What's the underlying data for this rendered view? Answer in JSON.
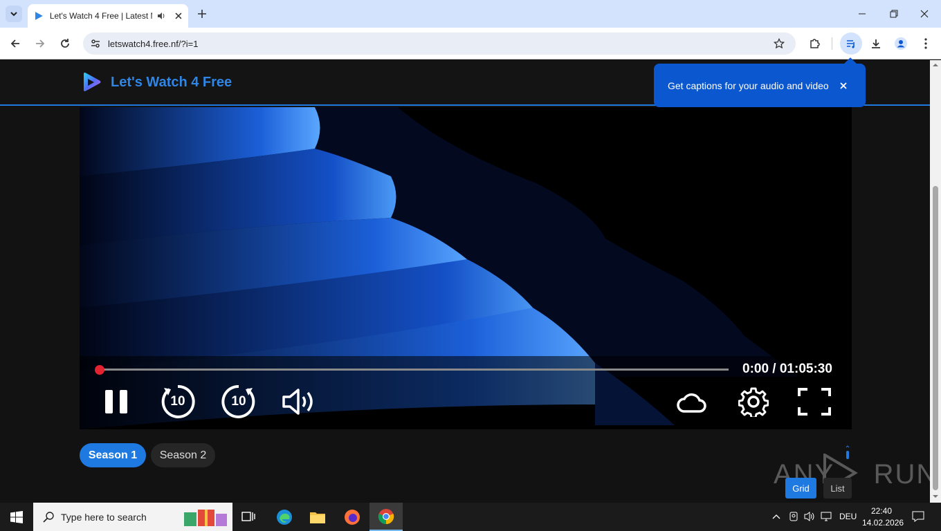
{
  "browser": {
    "tab_title": "Let's Watch 4 Free | Latest M",
    "url": "letswatch4.free.nf/?i=1"
  },
  "caption_popup": {
    "text": "Get captions for your audio and video"
  },
  "site": {
    "name": "Let's Watch 4 Free",
    "accent": "#1e7ae0"
  },
  "player": {
    "time": "0:00 / 01:05:30",
    "progress": 0.0,
    "rewind_label": "10",
    "forward_label": "10"
  },
  "seasons": [
    {
      "label": "Season 1",
      "active": true
    },
    {
      "label": "Season 2",
      "active": false
    }
  ],
  "view_toggle": {
    "grid": "Grid",
    "list": "List"
  },
  "watermark": "ANY RUN",
  "taskbar": {
    "search_placeholder": "Type here to search",
    "lang": "DEU",
    "time": "22:40",
    "date": "14.02.2026"
  }
}
